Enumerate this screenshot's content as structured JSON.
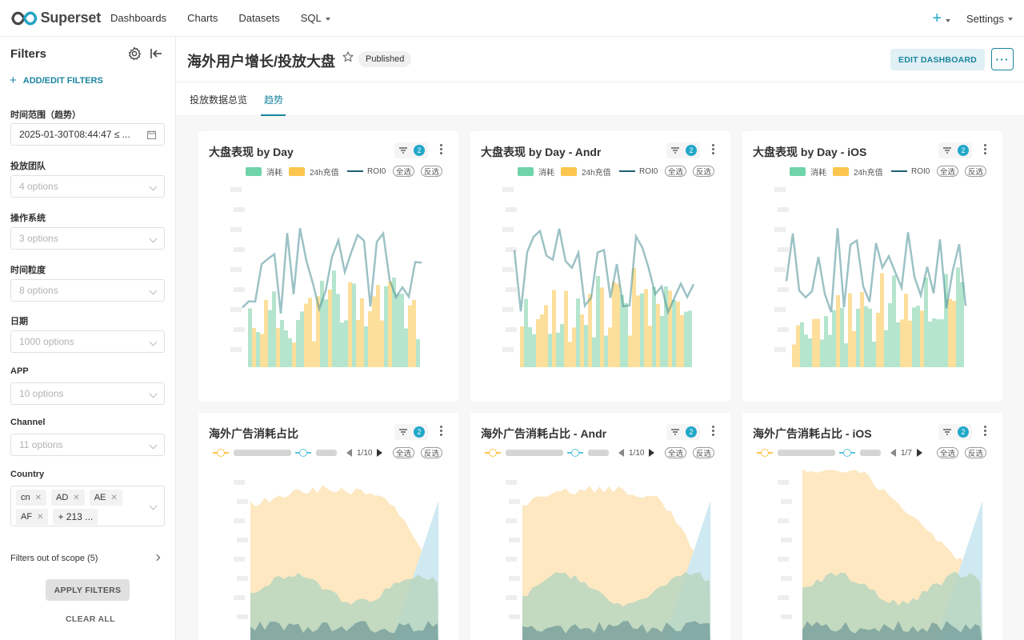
{
  "nav": {
    "brand": "Superset",
    "items": [
      "Dashboards",
      "Charts",
      "Datasets",
      "SQL"
    ],
    "settings_label": "Settings"
  },
  "sidebar": {
    "title": "Filters",
    "add_edit_label": "ADD/EDIT FILTERS",
    "filters": [
      {
        "label": "时间范围（趋势）",
        "value": "2025-01-30T08:44:47 ≤ ..."
      },
      {
        "label": "投放团队",
        "placeholder": "4 options"
      },
      {
        "label": "操作系统",
        "placeholder": "3 options"
      },
      {
        "label": "时间粒度",
        "placeholder": "8 options"
      },
      {
        "label": "日期",
        "placeholder": "1000 options"
      },
      {
        "label": "APP",
        "placeholder": "10 options"
      },
      {
        "label": "Channel",
        "placeholder": "11 options"
      },
      {
        "label": "Country",
        "tags": [
          "cn",
          "AD",
          "AE",
          "AF"
        ],
        "more": "+ 213 ..."
      }
    ],
    "out_of_scope_label": "Filters out of scope (5)",
    "apply_label": "APPLY FILTERS",
    "clear_label": "CLEAR ALL"
  },
  "header": {
    "title": "海外用户增长/投放大盘",
    "status": "Published",
    "edit_label": "EDIT DASHBOARD",
    "more_label": "···"
  },
  "tabs": [
    {
      "label": "投放数据总览",
      "active": false
    },
    {
      "label": "趋势",
      "active": true
    }
  ],
  "cards": [
    {
      "title": "大盘表现 by Day",
      "filter_count": "2",
      "legend": {
        "spend": "消耗",
        "recharge": "24h充值",
        "roi": "ROI0"
      },
      "select_all": "全选",
      "invert": "反选"
    },
    {
      "title": "大盘表现 by Day - Andr",
      "filter_count": "2",
      "legend": {
        "spend": "消耗",
        "recharge": "24h充值",
        "roi": "ROI0"
      },
      "select_all": "全选",
      "invert": "反选"
    },
    {
      "title": "大盘表现 by Day - iOS",
      "filter_count": "2",
      "legend": {
        "spend": "消耗",
        "recharge": "24h充值",
        "roi": "ROI0"
      },
      "select_all": "全选",
      "invert": "反选"
    },
    {
      "title": "海外广告消耗占比",
      "filter_count": "2",
      "page": "1/10",
      "select_all": "全选",
      "invert": "反选"
    },
    {
      "title": "海外广告消耗占比 - Andr",
      "filter_count": "2",
      "page": "1/10",
      "select_all": "全选",
      "invert": "反选"
    },
    {
      "title": "海外广告消耗占比 - iOS",
      "filter_count": "2",
      "page": "1/7",
      "select_all": "全选",
      "invert": "反选"
    }
  ],
  "colors": {
    "accent": "#1a85a0",
    "spend": "#6fd4a9",
    "recharge": "#fcc54d",
    "roi": "#1f5e74",
    "area_orange": "#fde8c2",
    "area_blue": "#bfe4f0",
    "area_green": "#a9cbb0"
  }
}
